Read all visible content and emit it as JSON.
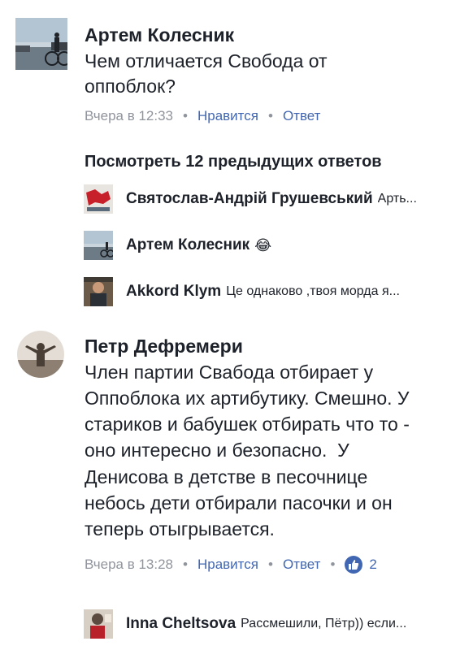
{
  "comment1": {
    "author": "Артем Колесник",
    "text_line1": "Чем отличается Свобода от",
    "text_line2": "оппоблок?",
    "time": "Вчера в 12:33",
    "like": "Нравится",
    "reply": "Ответ",
    "sep": "•"
  },
  "view_previous": "Посмотреть 12 предыдущих ответов",
  "replies": [
    {
      "author": "Святослав-Андрій Грушевський",
      "snippet": "Арть..."
    },
    {
      "author": "Артем Колесник",
      "emoji": "😂"
    },
    {
      "author": "Akkord Klym",
      "snippet": "Це однаково ,твоя морда я..."
    }
  ],
  "comment2": {
    "author": "Петр Дефремери",
    "lines": [
      "Член партии Свабода отбирает у",
      "Оппоблока их артибутику. Смешно. У",
      "стариков и бабушек отбирать что то -",
      "оно интересно и безопасно.  У",
      "Денисова в детстве в песочнице",
      "небось дети отбирали пасочки и он",
      "теперь отыгрывается."
    ],
    "time": "Вчера в 13:28",
    "like": "Нравится",
    "reply": "Ответ",
    "sep": "•",
    "reactions_count": "2"
  },
  "reply_last": {
    "author": "Inna Cheltsova",
    "snippet": "Рассмешили, Пётр)) если..."
  },
  "colors": {
    "link": "#4267b2",
    "meta": "#90949c",
    "text": "#1d2129"
  }
}
